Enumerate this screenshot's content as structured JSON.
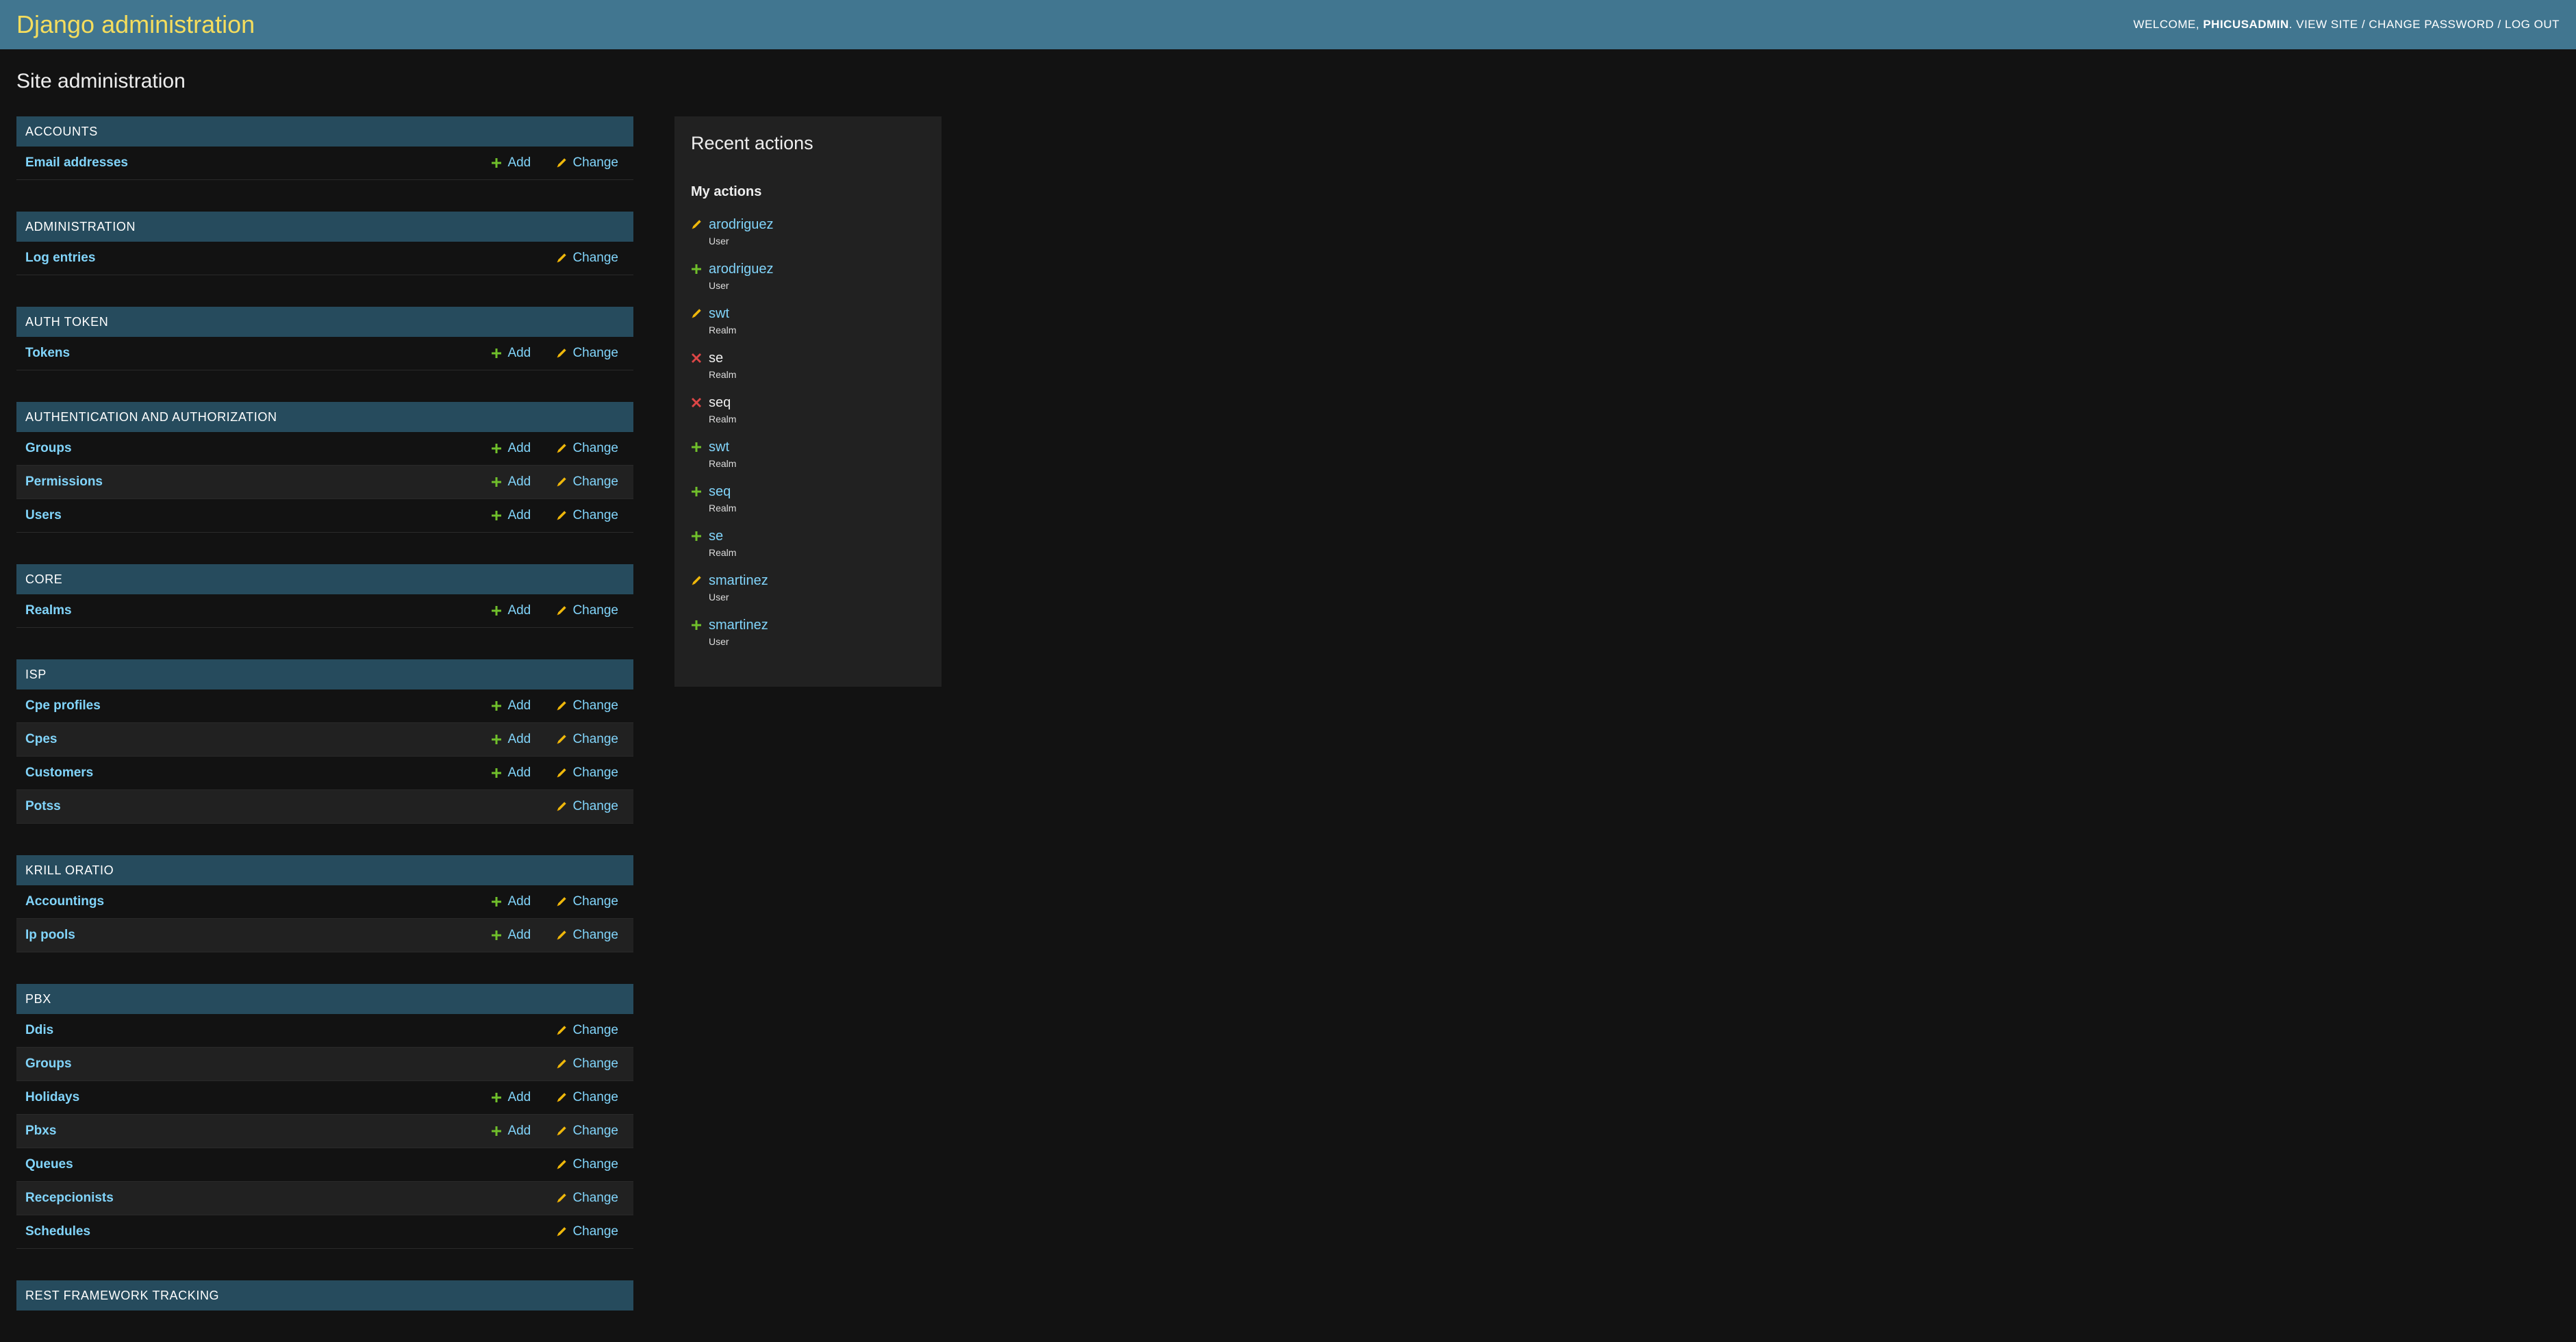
{
  "header": {
    "brand": "Django administration",
    "welcome_prefix": "WELCOME,",
    "username": "PHICUSADMIN",
    "view_site": "VIEW SITE",
    "change_password": "CHANGE PASSWORD",
    "log_out": "LOG OUT",
    "separator": "/"
  },
  "page_title": "Site administration",
  "links": {
    "add": "Add",
    "change": "Change"
  },
  "apps": [
    {
      "name": "ACCOUNTS",
      "models": [
        {
          "name": "Email addresses",
          "add": true,
          "change": true
        }
      ]
    },
    {
      "name": "ADMINISTRATION",
      "models": [
        {
          "name": "Log entries",
          "add": false,
          "change": true
        }
      ]
    },
    {
      "name": "AUTH TOKEN",
      "models": [
        {
          "name": "Tokens",
          "add": true,
          "change": true
        }
      ]
    },
    {
      "name": "AUTHENTICATION AND AUTHORIZATION",
      "models": [
        {
          "name": "Groups",
          "add": true,
          "change": true
        },
        {
          "name": "Permissions",
          "add": true,
          "change": true
        },
        {
          "name": "Users",
          "add": true,
          "change": true
        }
      ]
    },
    {
      "name": "CORE",
      "models": [
        {
          "name": "Realms",
          "add": true,
          "change": true
        }
      ]
    },
    {
      "name": "ISP",
      "models": [
        {
          "name": "Cpe profiles",
          "add": true,
          "change": true
        },
        {
          "name": "Cpes",
          "add": true,
          "change": true
        },
        {
          "name": "Customers",
          "add": true,
          "change": true
        },
        {
          "name": "Potss",
          "add": false,
          "change": true
        }
      ]
    },
    {
      "name": "KRILL ORATIO",
      "models": [
        {
          "name": "Accountings",
          "add": true,
          "change": true
        },
        {
          "name": "Ip pools",
          "add": true,
          "change": true
        }
      ]
    },
    {
      "name": "PBX",
      "models": [
        {
          "name": "Ddis",
          "add": false,
          "change": true
        },
        {
          "name": "Groups",
          "add": false,
          "change": true
        },
        {
          "name": "Holidays",
          "add": true,
          "change": true
        },
        {
          "name": "Pbxs",
          "add": true,
          "change": true
        },
        {
          "name": "Queues",
          "add": false,
          "change": true
        },
        {
          "name": "Recepcionists",
          "add": false,
          "change": true
        },
        {
          "name": "Schedules",
          "add": false,
          "change": true
        }
      ]
    },
    {
      "name": "REST FRAMEWORK TRACKING",
      "models": []
    }
  ],
  "recent_actions": {
    "title": "Recent actions",
    "subtitle": "My actions",
    "items": [
      {
        "action": "change",
        "name": "arodriguez",
        "type": "User"
      },
      {
        "action": "add",
        "name": "arodriguez",
        "type": "User"
      },
      {
        "action": "change",
        "name": "swt",
        "type": "Realm"
      },
      {
        "action": "delete",
        "name": "se",
        "type": "Realm"
      },
      {
        "action": "delete",
        "name": "seq",
        "type": "Realm"
      },
      {
        "action": "add",
        "name": "swt",
        "type": "Realm"
      },
      {
        "action": "add",
        "name": "seq",
        "type": "Realm"
      },
      {
        "action": "add",
        "name": "se",
        "type": "Realm"
      },
      {
        "action": "change",
        "name": "smartinez",
        "type": "User"
      },
      {
        "action": "add",
        "name": "smartinez",
        "type": "User"
      }
    ]
  },
  "colors": {
    "header_bg": "#417690",
    "brand": "#f5dd5d",
    "module_caption_bg": "#264b5d",
    "link": "#81d4fa",
    "add_icon": "#70bf2b",
    "change_icon": "#efb80b",
    "delete_icon": "#dd4646"
  }
}
